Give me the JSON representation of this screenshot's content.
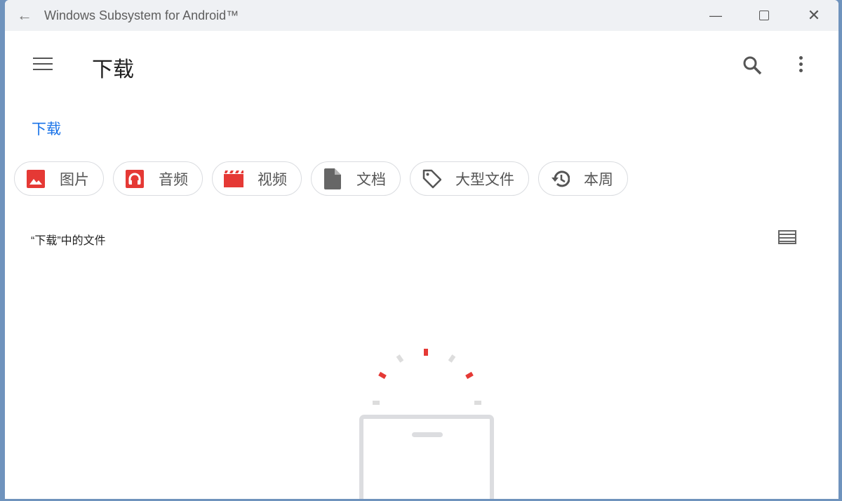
{
  "window": {
    "title": "Windows Subsystem for Android™",
    "back_icon": "arrow-left-icon"
  },
  "appbar": {
    "title": "下载"
  },
  "breadcrumb": "下载",
  "chips": [
    {
      "label": "图片",
      "icon": "image-icon",
      "color": "#e53935"
    },
    {
      "label": "音频",
      "icon": "headphones-icon",
      "color": "#e53935"
    },
    {
      "label": "视频",
      "icon": "movie-icon",
      "color": "#e53935"
    },
    {
      "label": "文档",
      "icon": "document-icon",
      "color": "#666666"
    },
    {
      "label": "大型文件",
      "icon": "tag-icon",
      "color": "#555555"
    },
    {
      "label": "本周",
      "icon": "history-icon",
      "color": "#555555"
    }
  ],
  "section_title": "“下载”中的文件"
}
